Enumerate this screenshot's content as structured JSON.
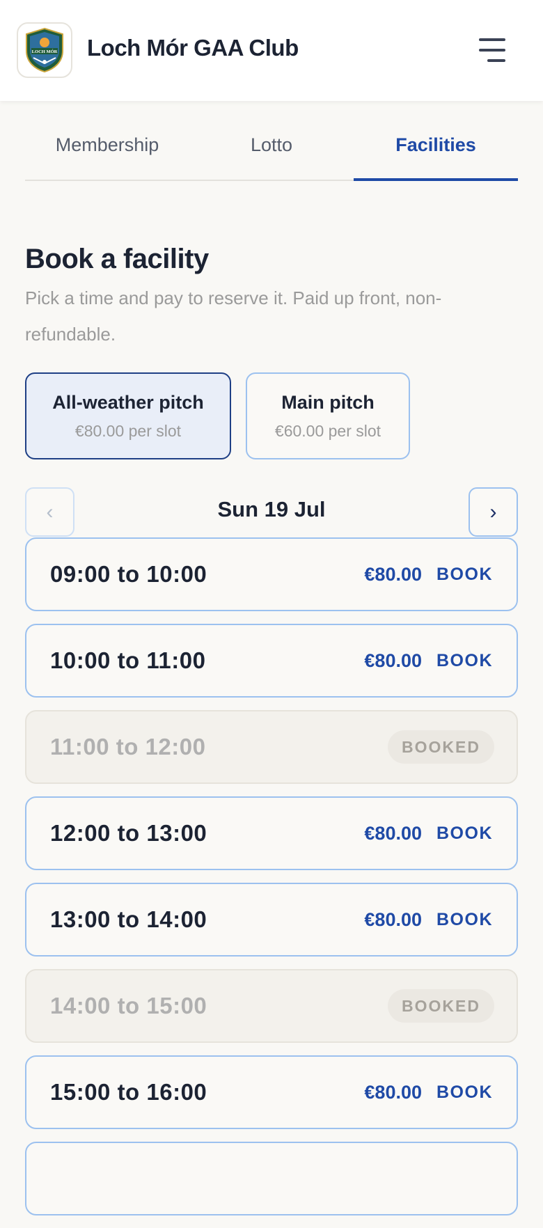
{
  "header": {
    "club_name": "Loch Mór GAA Club",
    "logo_text": "LOCH MÓR"
  },
  "tabs": [
    {
      "label": "Membership",
      "active": false
    },
    {
      "label": "Lotto",
      "active": false
    },
    {
      "label": "Facilities",
      "active": true
    }
  ],
  "main": {
    "title": "Book a facility",
    "subtitle": "Pick a time and pay to reserve it. Paid up front, non-refundable."
  },
  "facilities": [
    {
      "name": "All-weather pitch",
      "price": "€80.00 per slot",
      "selected": true
    },
    {
      "name": "Main pitch",
      "price": "€60.00 per slot",
      "selected": false
    }
  ],
  "date_nav": {
    "date": "Sun 19 Jul",
    "prev_icon": "‹",
    "next_icon": "›"
  },
  "slots": [
    {
      "time": "09:00 to 10:00",
      "price": "€80.00",
      "action": "BOOK",
      "status": "available"
    },
    {
      "time": "10:00 to 11:00",
      "price": "€80.00",
      "action": "BOOK",
      "status": "available"
    },
    {
      "time": "11:00 to 12:00",
      "badge": "BOOKED",
      "status": "booked"
    },
    {
      "time": "12:00 to 13:00",
      "price": "€80.00",
      "action": "BOOK",
      "status": "available"
    },
    {
      "time": "13:00 to 14:00",
      "price": "€80.00",
      "action": "BOOK",
      "status": "available"
    },
    {
      "time": "14:00 to 15:00",
      "badge": "BOOKED",
      "status": "booked"
    },
    {
      "time": "15:00 to 16:00",
      "price": "€80.00",
      "action": "BOOK",
      "status": "available"
    }
  ],
  "colors": {
    "accent": "#1f4aa6",
    "border": "#9cc1ef",
    "background": "#f9f8f5"
  }
}
